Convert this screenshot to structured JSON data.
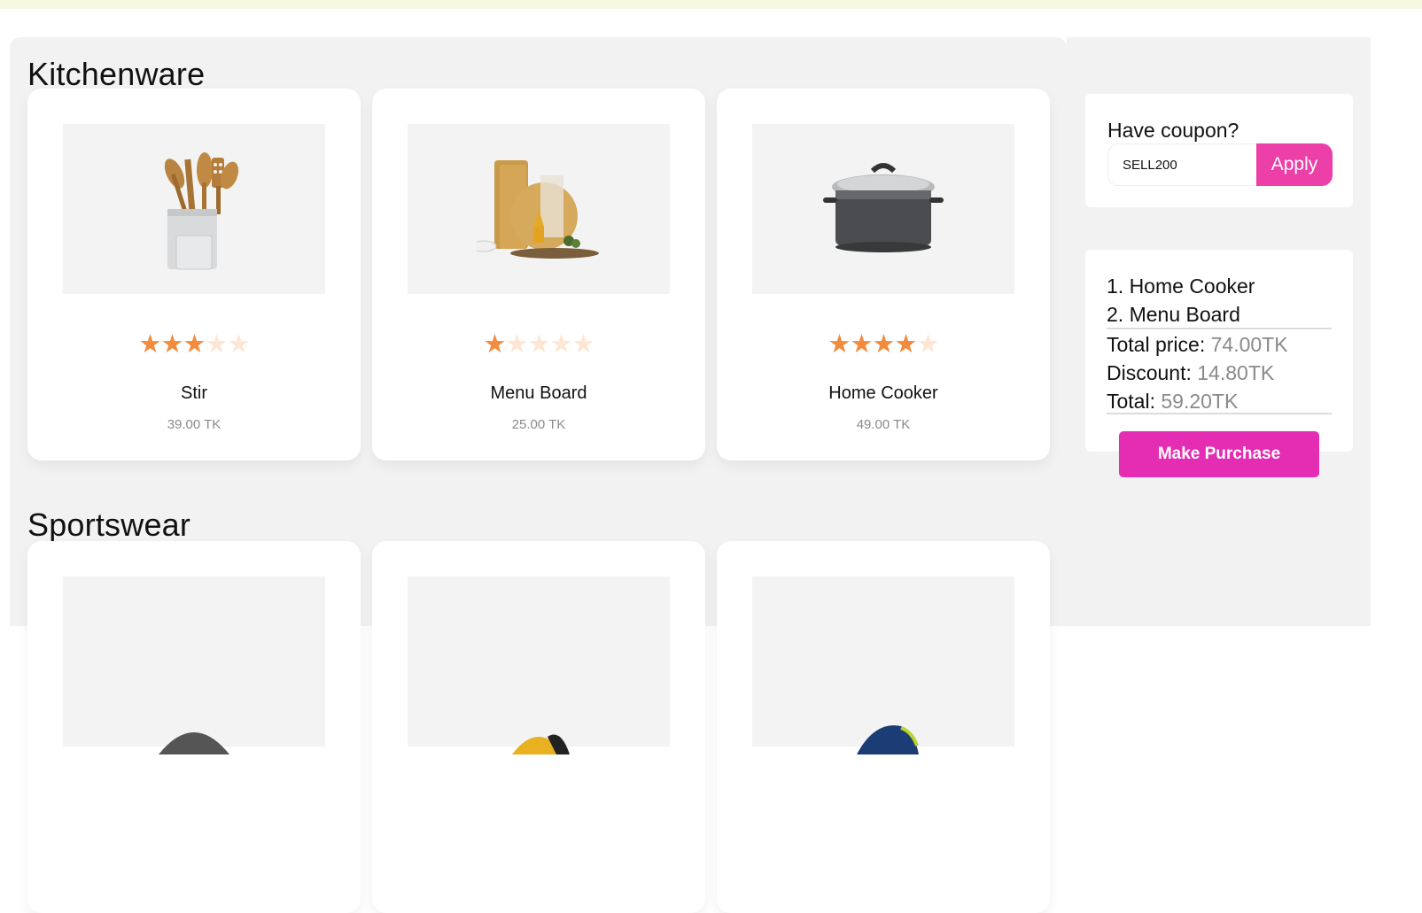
{
  "categories": [
    {
      "title": "Kitchenware",
      "products": [
        {
          "name": "Stir",
          "price": "39.00 TK",
          "rating": 3,
          "max_rating": 5,
          "image_icon": "utensil-holder-icon"
        },
        {
          "name": "Menu Board",
          "price": "25.00 TK",
          "rating": 1,
          "max_rating": 5,
          "image_icon": "cutting-board-icon"
        },
        {
          "name": "Home Cooker",
          "price": "49.00 TK",
          "rating": 4,
          "max_rating": 5,
          "image_icon": "cooking-pot-icon"
        }
      ]
    },
    {
      "title": "Sportswear",
      "products": [
        {
          "image_icon": "cap-icon"
        },
        {
          "image_icon": "helmet-icon"
        },
        {
          "image_icon": "sneaker-icon"
        }
      ]
    }
  ],
  "coupon": {
    "label": "Have coupon?",
    "value": "SELL200",
    "apply_label": "Apply"
  },
  "cart": {
    "items": [
      "1. Home Cooker",
      "2. Menu Board"
    ],
    "total_price_label": "Total price:",
    "total_price": "74.00TK",
    "discount_label": "Discount:",
    "discount": "14.80TK",
    "total_label": "Total:",
    "total": "59.20TK"
  },
  "purchase_label": "Make Purchase",
  "colors": {
    "accent": "#ec3fa8",
    "purchase": "#e52db3",
    "star_on": "#f28b3c",
    "star_off": "#fde6d3",
    "panel_bg": "#f2f2f2"
  }
}
